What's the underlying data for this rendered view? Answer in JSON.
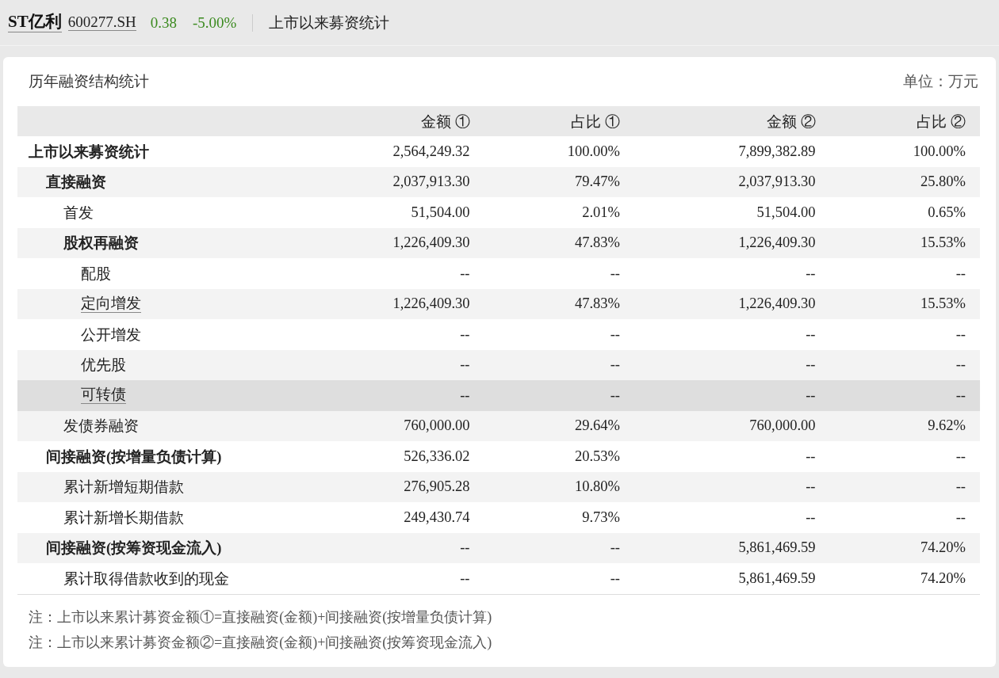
{
  "header": {
    "stock_name": "ST亿利",
    "stock_code": "600277.SH",
    "price": "0.38",
    "change": "-5.00%",
    "page_title": "上市以来募资统计"
  },
  "panel": {
    "title": "历年融资结构统计",
    "unit": "单位：万元"
  },
  "table": {
    "columns": [
      "",
      "金额 ①",
      "占比 ①",
      "金额 ②",
      "占比 ②"
    ],
    "rows": [
      {
        "label": "上市以来募资统计",
        "link": false,
        "selected": false,
        "values": [
          "2,564,249.32",
          "100.00%",
          "7,899,382.89",
          "100.00%"
        ],
        "children": [
          {
            "label": "直接融资",
            "link": false,
            "selected": false,
            "values": [
              "2,037,913.30",
              "79.47%",
              "2,037,913.30",
              "25.80%"
            ],
            "children": [
              {
                "label": "首发",
                "link": false,
                "selected": false,
                "values": [
                  "51,504.00",
                  "2.01%",
                  "51,504.00",
                  "0.65%"
                ]
              },
              {
                "label": "股权再融资",
                "link": false,
                "selected": false,
                "values": [
                  "1,226,409.30",
                  "47.83%",
                  "1,226,409.30",
                  "15.53%"
                ],
                "children": [
                  {
                    "label": "配股",
                    "link": false,
                    "selected": false,
                    "values": [
                      "--",
                      "--",
                      "--",
                      "--"
                    ]
                  },
                  {
                    "label": "定向增发",
                    "link": true,
                    "selected": false,
                    "values": [
                      "1,226,409.30",
                      "47.83%",
                      "1,226,409.30",
                      "15.53%"
                    ]
                  },
                  {
                    "label": "公开增发",
                    "link": false,
                    "selected": false,
                    "values": [
                      "--",
                      "--",
                      "--",
                      "--"
                    ]
                  },
                  {
                    "label": "优先股",
                    "link": false,
                    "selected": false,
                    "values": [
                      "--",
                      "--",
                      "--",
                      "--"
                    ]
                  },
                  {
                    "label": "可转债",
                    "link": true,
                    "selected": true,
                    "values": [
                      "--",
                      "--",
                      "--",
                      "--"
                    ]
                  }
                ]
              },
              {
                "label": "发债券融资",
                "link": false,
                "selected": false,
                "values": [
                  "760,000.00",
                  "29.64%",
                  "760,000.00",
                  "9.62%"
                ]
              }
            ]
          },
          {
            "label": "间接融资(按增量负债计算)",
            "link": false,
            "selected": false,
            "values": [
              "526,336.02",
              "20.53%",
              "--",
              "--"
            ],
            "children": [
              {
                "label": "累计新增短期借款",
                "link": false,
                "selected": false,
                "values": [
                  "276,905.28",
                  "10.80%",
                  "--",
                  "--"
                ]
              },
              {
                "label": "累计新增长期借款",
                "link": false,
                "selected": false,
                "values": [
                  "249,430.74",
                  "9.73%",
                  "--",
                  "--"
                ]
              }
            ]
          },
          {
            "label": "间接融资(按筹资现金流入)",
            "link": false,
            "selected": false,
            "values": [
              "--",
              "--",
              "5,861,469.59",
              "74.20%"
            ],
            "children": [
              {
                "label": "累计取得借款收到的现金",
                "link": false,
                "selected": false,
                "values": [
                  "--",
                  "--",
                  "5,861,469.59",
                  "74.20%"
                ]
              }
            ]
          }
        ]
      }
    ]
  },
  "notes": [
    "注：上市以来累计募资金额①=直接融资(金额)+间接融资(按增量负债计算)",
    "注：上市以来累计募资金额②=直接融资(金额)+间接融资(按筹资现金流入)"
  ]
}
